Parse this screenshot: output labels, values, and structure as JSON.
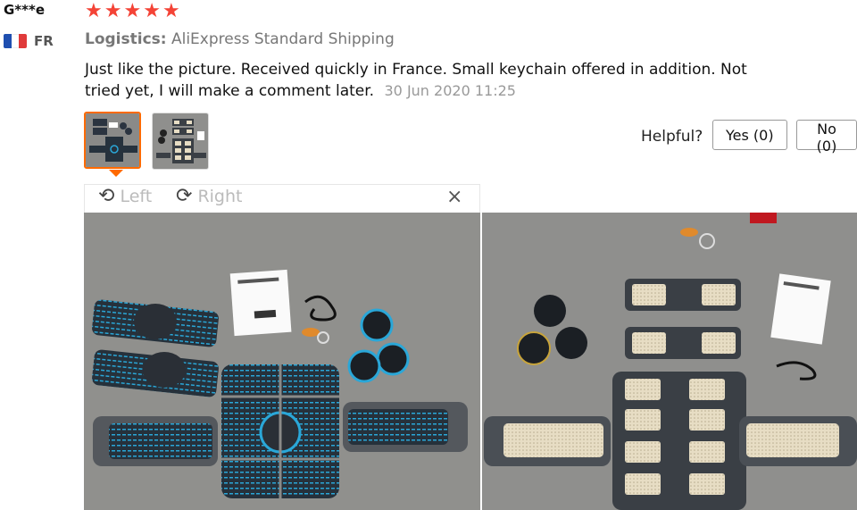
{
  "reviewer": {
    "name": "G***e",
    "country": "FR",
    "flag_colors": [
      "#1f4fb0",
      "#ffffff",
      "#e03a3a"
    ],
    "rating": 5
  },
  "logistics": {
    "label": "Logistics:",
    "value": "AliExpress Standard Shipping"
  },
  "review": {
    "text": "Just like the picture. Received quickly in France. Small keychain offered in addition. Not tried yet, I will make a comment later.",
    "date": "30 Jun 2020 11:25"
  },
  "helpful": {
    "label": "Helpful?",
    "yes": "Yes (0)",
    "no": "No (0)"
  },
  "viewer": {
    "left": "Left",
    "right": "Right",
    "close": "×"
  },
  "colors": {
    "star": "#f44336",
    "active_border": "#ff6a00",
    "mat_blue": "#2aa7d8",
    "pad_beige": "#e7ddc4",
    "floor": "#8a8a88"
  },
  "icons": [
    "star-icon",
    "rotate-left-icon",
    "rotate-right-icon",
    "close-icon"
  ]
}
